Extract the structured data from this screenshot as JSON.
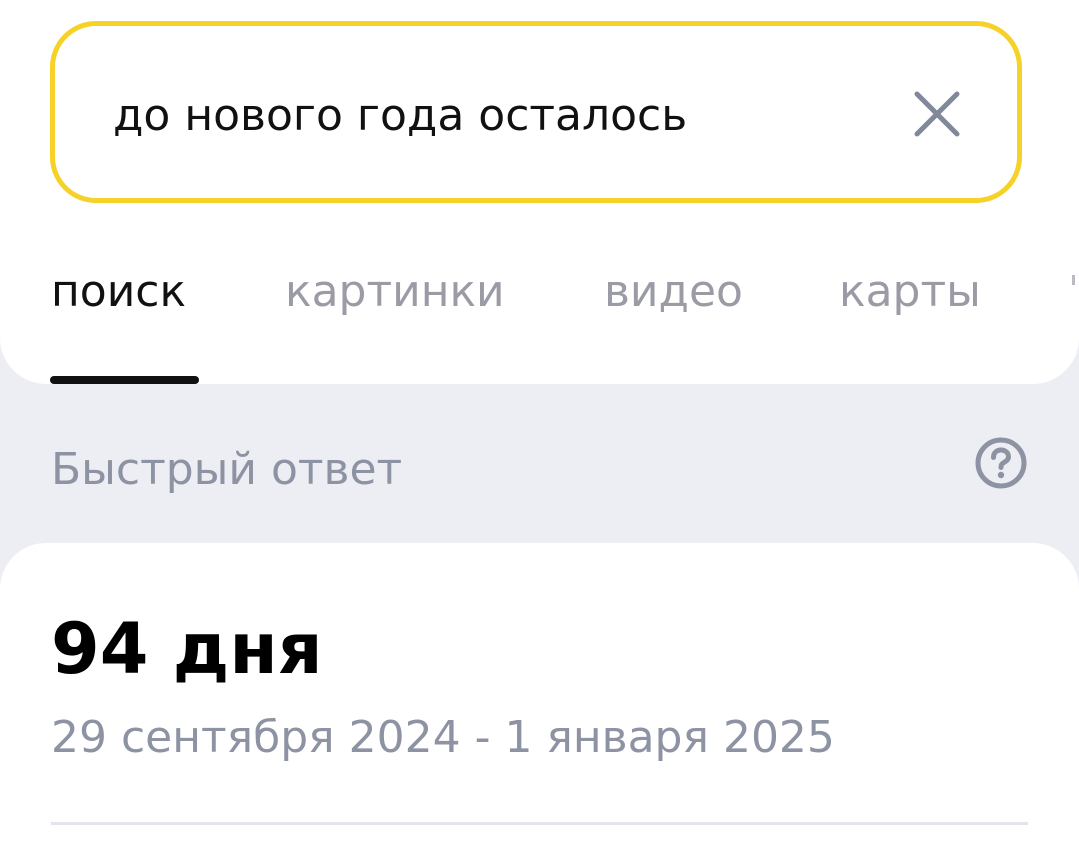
{
  "search": {
    "query": "до нового года осталось",
    "clear_icon": "close-icon",
    "border_color": "#f6d128"
  },
  "tabs": [
    {
      "label": "поиск",
      "active": true
    },
    {
      "label": "картинки",
      "active": false
    },
    {
      "label": "видео",
      "active": false
    },
    {
      "label": "карты",
      "active": false
    }
  ],
  "quick_answer": {
    "title": "Быстрый ответ",
    "help_icon": "question-circle-icon",
    "value": "94 дня",
    "range": "29 сентября 2024 - 1 января 2025"
  },
  "colors": {
    "background": "#eceef3",
    "accent": "#f6d128",
    "muted_text": "#8d93a3"
  }
}
